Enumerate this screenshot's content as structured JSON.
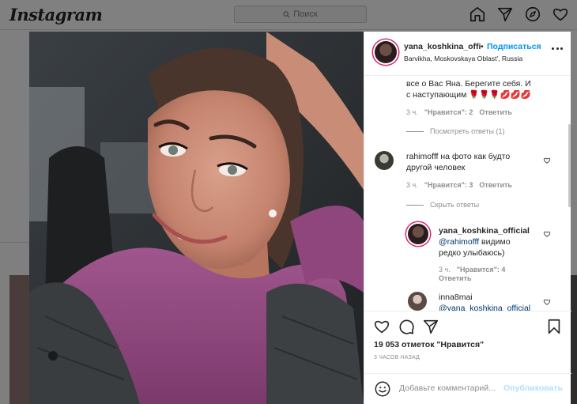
{
  "app": {
    "logo": "Instagram"
  },
  "search": {
    "placeholder": "Поиск"
  },
  "nav": {
    "icons": [
      "home-icon",
      "direct-icon",
      "explore-icon",
      "activity-heart-icon"
    ]
  },
  "post": {
    "author": "yana_koshkina_offi",
    "follow_label": "Подписаться",
    "separator": "•",
    "location": "Barvikha, Moskovskaya Oblast', Russia",
    "likes_text": "19 053 отметок \"Нравится\"",
    "time_ago": "3 ЧАСОВ НАЗАД",
    "add_comment_placeholder": "Добавьте комментарий...",
    "publish_label": "Опубликовать"
  },
  "comments": {
    "first": {
      "line1": "все о Вас Яна. Берегите себя. И",
      "line2": "с наступающим",
      "emoji": "🌹🌹🌹💋💋💋",
      "time": "3 ч.",
      "likes": "\"Нравится\": 2",
      "reply_label": "Ответить",
      "view_replies": "Посмотреть ответы (1)"
    },
    "second": {
      "user": "rahimofff",
      "line1": "rahimofff на фото как будто",
      "line2": "другой человек",
      "time": "3 ч.",
      "likes": "\"Нравится\": 3",
      "reply_label": "Ответить",
      "hide_replies": "Скрыть ответы"
    },
    "reply": {
      "user": "yana_koshkina_official",
      "mention": "@rahimofff",
      "text_line1_rest": " видимо",
      "line2": "редко улыбаюсь)",
      "time": "3 ч.",
      "likes": "\"Нравится\": 4",
      "reply_label": "Ответить"
    },
    "third": {
      "user": "inna8mai",
      "mention": "@yana_koshkina_official"
    }
  },
  "colors": {
    "accent_blue": "#0095f6",
    "mention_blue": "#00376b",
    "muted": "#8e8e8e",
    "story_ring": "#d62976"
  }
}
